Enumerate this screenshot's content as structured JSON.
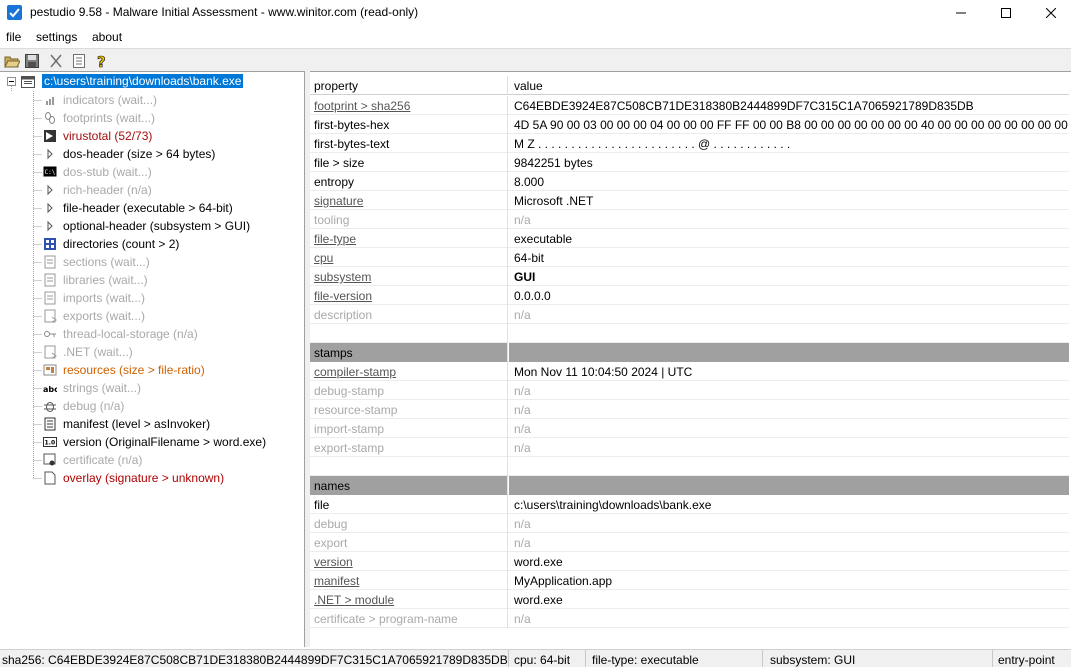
{
  "window": {
    "title": "pestudio 9.58 - Malware Initial Assessment - www.winitor.com (read-only)"
  },
  "menu": [
    "file",
    "settings",
    "about"
  ],
  "toolbar": [
    "open-icon",
    "save-icon",
    "cut-icon",
    "list-icon",
    "help-icon"
  ],
  "tree": {
    "root": "c:\\users\\training\\downloads\\bank.exe",
    "items": [
      {
        "label": "indicators (wait...)",
        "color": "gray",
        "icon": "indicators-icon"
      },
      {
        "label": "footprints (wait...)",
        "color": "gray",
        "icon": "footprints-icon"
      },
      {
        "label": "virustotal (52/73)",
        "color": "darkred",
        "icon": "virustotal-icon"
      },
      {
        "label": "dos-header (size > 64 bytes)",
        "color": "black",
        "icon": "arrow-icon"
      },
      {
        "label": "dos-stub (wait...)",
        "color": "gray",
        "icon": "dos-stub-icon"
      },
      {
        "label": "rich-header (n/a)",
        "color": "gray",
        "icon": "arrow-icon"
      },
      {
        "label": "file-header (executable > 64-bit)",
        "color": "black",
        "icon": "arrow-icon"
      },
      {
        "label": "optional-header (subsystem > GUI)",
        "color": "black",
        "icon": "arrow-icon"
      },
      {
        "label": "directories (count > 2)",
        "color": "black",
        "icon": "directories-icon"
      },
      {
        "label": "sections (wait...)",
        "color": "gray",
        "icon": "sections-icon"
      },
      {
        "label": "libraries (wait...)",
        "color": "gray",
        "icon": "libraries-icon"
      },
      {
        "label": "imports (wait...)",
        "color": "gray",
        "icon": "imports-icon"
      },
      {
        "label": "exports (wait...)",
        "color": "gray",
        "icon": "exports-icon"
      },
      {
        "label": "thread-local-storage (n/a)",
        "color": "gray",
        "icon": "tls-icon"
      },
      {
        "label": ".NET (wait...)",
        "color": "gray",
        "icon": "dotnet-icon"
      },
      {
        "label": "resources (size > file-ratio)",
        "color": "orange",
        "icon": "resources-icon"
      },
      {
        "label": "strings (wait...)",
        "color": "gray",
        "icon": "strings-icon"
      },
      {
        "label": "debug (n/a)",
        "color": "gray",
        "icon": "debug-icon"
      },
      {
        "label": "manifest (level > asInvoker)",
        "color": "black",
        "icon": "manifest-icon"
      },
      {
        "label": "version (OriginalFilename > word.exe)",
        "color": "black",
        "icon": "version-icon"
      },
      {
        "label": "certificate (n/a)",
        "color": "gray",
        "icon": "certificate-icon"
      },
      {
        "label": "overlay (signature > unknown)",
        "color": "red",
        "icon": "overlay-icon"
      }
    ]
  },
  "table": {
    "header": {
      "property": "property",
      "value": "value"
    },
    "rows": [
      {
        "p": "footprint > sha256",
        "v": "C64EBDE3924E87C508CB71DE318380B2444899DF7C315C1A7065921789D835DB",
        "ps": "link",
        "vs": "black"
      },
      {
        "p": "first-bytes-hex",
        "v": "4D 5A 90 00 03 00 00 00 04 00 00 00 FF FF 00 00 B8 00 00 00 00 00 00 00 40 00 00 00 00 00 00 00 00",
        "ps": "black",
        "vs": "black"
      },
      {
        "p": "first-bytes-text",
        "v": "M Z . . . . . . . . . . . . . . . . . . . . . . . . @ . . . . . . . . . . . .",
        "ps": "black",
        "vs": "black"
      },
      {
        "p": "file > size",
        "v": "9842251 bytes",
        "ps": "black",
        "vs": "black"
      },
      {
        "p": "entropy",
        "v": "8.000",
        "ps": "black",
        "vs": "black"
      },
      {
        "p": "signature",
        "v": "Microsoft .NET",
        "ps": "link",
        "vs": "black"
      },
      {
        "p": "tooling",
        "v": "n/a",
        "ps": "gray",
        "vs": "gray"
      },
      {
        "p": "file-type",
        "v": "executable",
        "ps": "link",
        "vs": "black"
      },
      {
        "p": "cpu",
        "v": "64-bit",
        "ps": "link",
        "vs": "black"
      },
      {
        "p": "subsystem",
        "v": "GUI",
        "ps": "link",
        "vs": "bold"
      },
      {
        "p": "file-version",
        "v": "0.0.0.0",
        "ps": "link",
        "vs": "black"
      },
      {
        "p": "description",
        "v": "n/a",
        "ps": "gray",
        "vs": "gray"
      },
      {
        "p": "",
        "v": "",
        "ps": "black",
        "vs": "black"
      },
      {
        "p": "stamps",
        "v": "",
        "ps": "section",
        "vs": "section"
      },
      {
        "p": "compiler-stamp",
        "v": "Mon Nov 11 10:04:50 2024 | UTC",
        "ps": "link",
        "vs": "black"
      },
      {
        "p": "debug-stamp",
        "v": "n/a",
        "ps": "gray",
        "vs": "gray"
      },
      {
        "p": "resource-stamp",
        "v": "n/a",
        "ps": "gray",
        "vs": "gray"
      },
      {
        "p": "import-stamp",
        "v": "n/a",
        "ps": "gray",
        "vs": "gray"
      },
      {
        "p": "export-stamp",
        "v": "n/a",
        "ps": "gray",
        "vs": "gray"
      },
      {
        "p": "",
        "v": "",
        "ps": "black",
        "vs": "black"
      },
      {
        "p": "names",
        "v": "",
        "ps": "section",
        "vs": "section"
      },
      {
        "p": "file",
        "v": "c:\\users\\training\\downloads\\bank.exe",
        "ps": "black",
        "vs": "black"
      },
      {
        "p": "debug",
        "v": "n/a",
        "ps": "gray",
        "vs": "gray"
      },
      {
        "p": "export",
        "v": "n/a",
        "ps": "gray",
        "vs": "gray"
      },
      {
        "p": "version",
        "v": "word.exe",
        "ps": "link",
        "vs": "black"
      },
      {
        "p": "manifest",
        "v": "MyApplication.app",
        "ps": "link",
        "vs": "black"
      },
      {
        "p": ".NET > module",
        "v": "word.exe",
        "ps": "link",
        "vs": "black"
      },
      {
        "p": "certificate > program-name",
        "v": "n/a",
        "ps": "gray",
        "vs": "gray"
      }
    ]
  },
  "status": {
    "sha256": "sha256: C64EBDE3924E87C508CB71DE318380B2444899DF7C315C1A7065921789D835DB",
    "cpu": "cpu: 64-bit",
    "filetype": "file-type: executable",
    "subsystem": "subsystem: GUI",
    "entrypoint": "entry-point"
  },
  "colors": {
    "selection": "#0078d7",
    "section": "#a0a0a0",
    "red": "#b00000",
    "orange": "#d06000"
  }
}
